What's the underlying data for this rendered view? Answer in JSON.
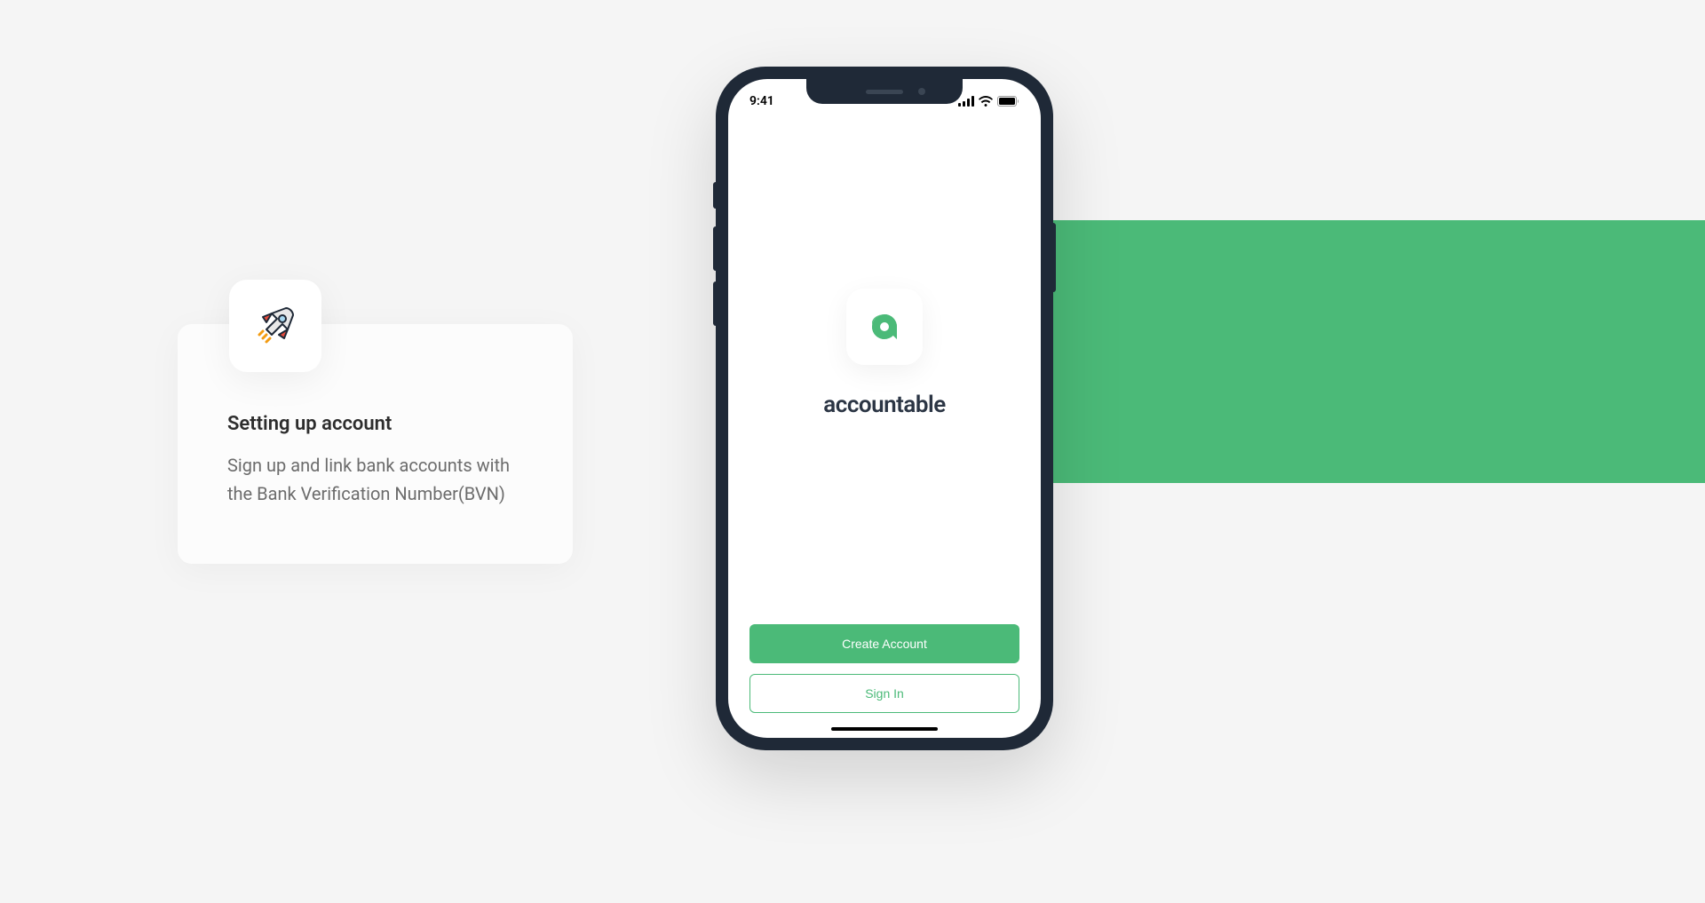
{
  "accentColor": "#4BBA78",
  "feature": {
    "title": "Setting up account",
    "description": "Sign up and link bank accounts with the Bank Verification Number(BVN)",
    "iconName": "rocket-icon"
  },
  "phone": {
    "statusBar": {
      "time": "9:41",
      "signalIcon": "signal-icon",
      "wifiIcon": "wifi-icon",
      "batteryIcon": "battery-icon"
    },
    "app": {
      "name": "accountable",
      "logoIcon": "accountable-logo",
      "buttons": {
        "primary": "Create Account",
        "secondary": "Sign In"
      }
    }
  }
}
